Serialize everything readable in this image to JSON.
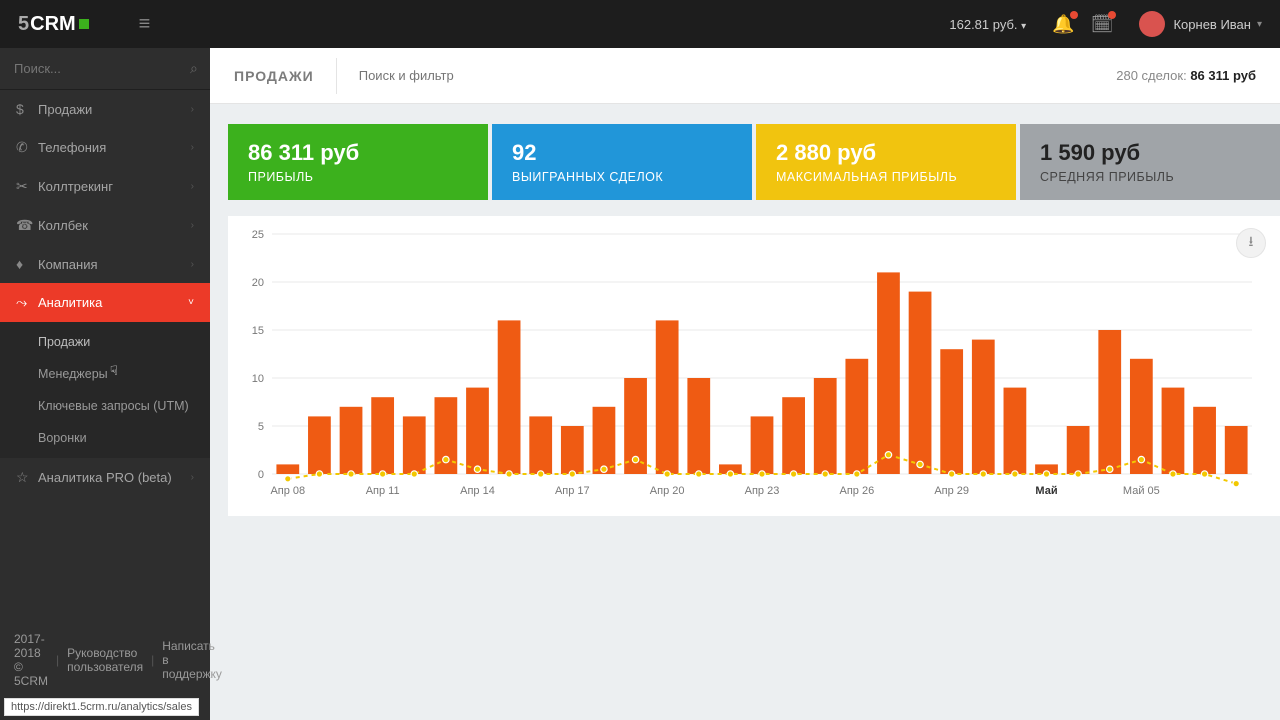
{
  "brand": {
    "s5": "5",
    "crm": "CRM"
  },
  "topbar": {
    "balance": "162.81 руб.",
    "user": "Корнев Иван"
  },
  "search": {
    "placeholder": "Поиск..."
  },
  "sidebar": {
    "items": [
      {
        "icon": "$",
        "label": "Продажи"
      },
      {
        "icon": "✆",
        "label": "Телефония"
      },
      {
        "icon": "✂",
        "label": "Коллтрекинг"
      },
      {
        "icon": "☎",
        "label": "Коллбек"
      },
      {
        "icon": "♦",
        "label": "Компания"
      },
      {
        "icon": "⤳",
        "label": "Аналитика"
      },
      {
        "icon": "☆",
        "label": "Аналитика PRO (beta)"
      }
    ],
    "subitems": [
      {
        "label": "Продажи"
      },
      {
        "label": "Менеджеры"
      },
      {
        "label": "Ключевые запросы (UTM)"
      },
      {
        "label": "Воронки"
      }
    ]
  },
  "header": {
    "title": "ПРОДАЖИ",
    "filter_placeholder": "Поиск и фильтр",
    "deals_pre": "280 сделок: ",
    "deals_total": "86 311 руб"
  },
  "kpi": [
    {
      "value": "86 311 руб",
      "label": "ПРИБЫЛЬ"
    },
    {
      "value": "92",
      "label": "ВЫИГРАННЫХ СДЕЛОК"
    },
    {
      "value": "2 880 руб",
      "label": "МАКСИМАЛЬНАЯ ПРИБЫЛЬ"
    },
    {
      "value": "1 590 руб",
      "label": "СРЕДНЯЯ ПРИБЫЛЬ"
    }
  ],
  "chart_data": {
    "type": "bar",
    "title": "",
    "ylabel": "",
    "ylim": [
      0,
      25
    ],
    "yticks": [
      0,
      5,
      10,
      15,
      20,
      25
    ],
    "xticks": [
      "Апр 08",
      "Апр 11",
      "Апр 14",
      "Апр 17",
      "Апр 20",
      "Апр 23",
      "Апр 26",
      "Апр 29",
      "Май",
      "Май 05"
    ],
    "xtick_idx": [
      0,
      3,
      6,
      9,
      12,
      15,
      18,
      21,
      24,
      27
    ],
    "series": [
      {
        "name": "bars",
        "type": "bar",
        "values": [
          1,
          6,
          7,
          8,
          6,
          8,
          9,
          16,
          6,
          5,
          7,
          10,
          16,
          10,
          1,
          6,
          8,
          10,
          12,
          21,
          19,
          13,
          14,
          9,
          1,
          5,
          15,
          12,
          9,
          7,
          5
        ]
      },
      {
        "name": "line",
        "type": "line",
        "values": [
          -0.5,
          0,
          0,
          0,
          0,
          1.5,
          0.5,
          0,
          0,
          0,
          0.5,
          1.5,
          0,
          0,
          0,
          0,
          0,
          0,
          0,
          2,
          1,
          0,
          0,
          0,
          0,
          0,
          0.5,
          1.5,
          0,
          0,
          -1
        ]
      }
    ]
  },
  "footer": {
    "copyright": "2017-2018 © 5CRM",
    "manual": "Руководство пользователя",
    "support": "Написать в поддержку"
  },
  "status_url": "https://direkt1.5crm.ru/analytics/sales"
}
